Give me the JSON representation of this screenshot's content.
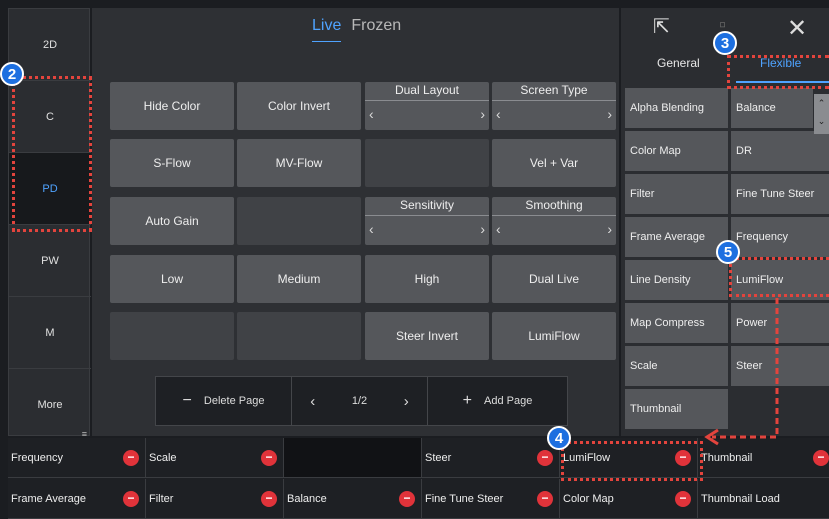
{
  "nav": {
    "items": [
      "2D",
      "C",
      "PD",
      "PW",
      "M",
      "More"
    ],
    "active": "PD"
  },
  "tabs": {
    "live": "Live",
    "frozen": "Frozen"
  },
  "buttons": {
    "hide_color": "Hide Color",
    "color_invert": "Color Invert",
    "s_flow": "S-Flow",
    "mv_flow": "MV-Flow",
    "vel_var": "Vel + Var",
    "auto_gain": "Auto Gain",
    "low": "Low",
    "medium": "Medium",
    "high": "High",
    "dual_live": "Dual Live",
    "steer_invert": "Steer Invert",
    "lumiflow": "LumiFlow"
  },
  "controls": {
    "dual_layout": "Dual Layout",
    "screen_type": "Screen Type",
    "sensitivity": "Sensitivity",
    "smoothing": "Smoothing"
  },
  "pager": {
    "delete": "Delete Page",
    "page": "1/2",
    "add": "Add Page"
  },
  "right_panel": {
    "general_tab": "General",
    "flexible_tab": "Flexible",
    "left_col": [
      "Alpha Blending",
      "Color Map",
      "Filter",
      "Frame Average",
      "Line Density",
      "Map Compress",
      "Scale",
      "Thumbnail"
    ],
    "right_col": [
      "Balance",
      "DR",
      "Fine Tune Steer",
      "Frequency",
      "LumiFlow",
      "Power",
      "Steer",
      ""
    ]
  },
  "bottom_bar": {
    "row1": [
      "Frequency",
      "Scale",
      "",
      "Steer",
      "LumiFlow",
      "Thumbnail"
    ],
    "row2": [
      "Frame Average",
      "Filter",
      "Balance",
      "Fine Tune Steer",
      "Color Map",
      "Thumbnail Load"
    ]
  },
  "badges": [
    "2",
    "3",
    "4",
    "5"
  ],
  "colors": {
    "accent": "#4fa3ff",
    "annotation": "#e3443d",
    "badge": "#1d6fe0",
    "remove": "#e0333a"
  }
}
